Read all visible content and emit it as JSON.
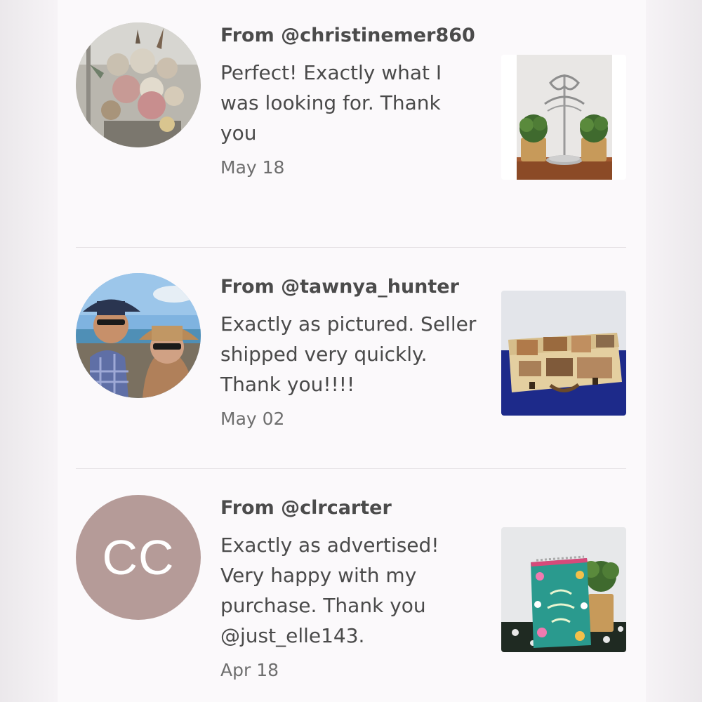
{
  "reviews": [
    {
      "from": "From @christinemer860",
      "comment": "Perfect! Exactly what I was looking for. Thank you",
      "date": "May 18",
      "avatar": {
        "type": "photo",
        "icon": "flower-arrangement-photo"
      },
      "thumbnail": {
        "icon": "jewelry-stand-with-plants-photo"
      }
    },
    {
      "from": "From @tawnya_hunter",
      "comment": "Exactly as pictured. Seller shipped very quickly. Thank you!!!!",
      "date": "May 02",
      "avatar": {
        "type": "photo",
        "icon": "couple-at-beach-photo"
      },
      "thumbnail": {
        "icon": "decorative-suitcase-box-photo"
      }
    },
    {
      "from": "From @clrcarter",
      "comment": "Exactly as advertised! Very happy with my purchase. Thank you @just_elle143.",
      "date": "Apr 18",
      "avatar": {
        "type": "initials",
        "initials": "CC",
        "color": "#b59b98"
      },
      "thumbnail": {
        "icon": "floral-notebook-with-plant-photo"
      }
    }
  ],
  "colors": {
    "panel_background": "#fbf9fb",
    "text_primary": "#4a4a4a",
    "text_secondary": "#6e6e6e",
    "divider": "#e7e3e6",
    "initials_avatar": "#b59b98"
  }
}
